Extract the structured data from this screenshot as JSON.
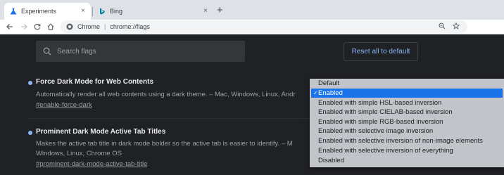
{
  "tabs": [
    {
      "title": "Experiments",
      "close": "×"
    },
    {
      "title": "Bing",
      "close": "×"
    }
  ],
  "new_tab_label": "+",
  "omnibox": {
    "site": "Chrome",
    "separator": "|",
    "url": "chrome://flags"
  },
  "search": {
    "placeholder": "Search flags"
  },
  "reset_label": "Reset all to default",
  "flags": [
    {
      "title": "Force Dark Mode for Web Contents",
      "description": "Automatically render all web contents using a dark theme. – Mac, Windows, Linux, Andr",
      "link": "#enable-force-dark"
    },
    {
      "title": "Prominent Dark Mode Active Tab Titles",
      "description_line1": "Makes the active tab title in dark mode bolder so the active tab is easier to identify. – M",
      "description_line2": "Windows, Linux, Chrome OS",
      "link": "#prominent-dark-mode-active-tab-title"
    }
  ],
  "dropdown": {
    "check": "✓",
    "options": [
      "Default",
      "Enabled",
      "Enabled with simple HSL-based inversion",
      "Enabled with simple CIELAB-based inversion",
      "Enabled with simple RGB-based inversion",
      "Enabled with selective image inversion",
      "Enabled with selective inversion of non-image elements",
      "Enabled with selective inversion of everything",
      "Disabled"
    ],
    "selected": "Enabled"
  },
  "colors": {
    "accent": "#1a73e8",
    "link": "#8ab4f8",
    "page_bg": "#202124",
    "bing": "#00809d"
  }
}
